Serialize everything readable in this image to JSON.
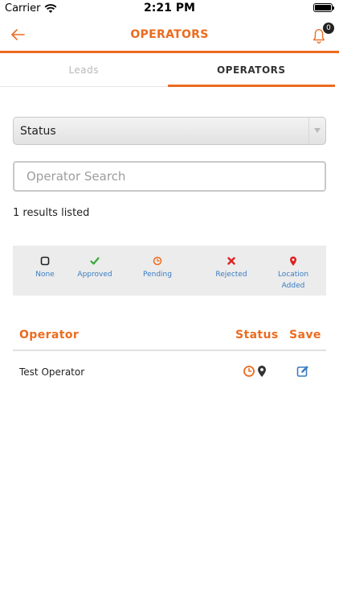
{
  "status_bar": {
    "carrier": "Carrier",
    "time": "2:21 PM"
  },
  "header": {
    "title": "OPERATORS",
    "notification_count": "0",
    "accent_color": "#ec6b1f"
  },
  "tabs": [
    {
      "label": "Leads",
      "active": false
    },
    {
      "label": "OPERATORS",
      "active": true
    }
  ],
  "status_filter": {
    "selected": "Status"
  },
  "search": {
    "placeholder": "Operator Search",
    "value": ""
  },
  "results_text": "1 results listed",
  "legend": [
    {
      "icon": "square-icon",
      "label": "None",
      "color": "#222222"
    },
    {
      "icon": "checkmark-icon",
      "label": "Approved",
      "color": "#3aa83a"
    },
    {
      "icon": "clock-icon",
      "label": "Pending",
      "color": "#ec6b1f"
    },
    {
      "icon": "x-icon",
      "label": "Rejected",
      "color": "#e02020"
    },
    {
      "icon": "location-pin-icon",
      "label_line1": "Location",
      "label_line2": "Added",
      "color": "#e02020"
    }
  ],
  "table": {
    "columns": {
      "operator": "Operator",
      "status": "Status",
      "save": "Save"
    },
    "rows": [
      {
        "name": "Test Operator",
        "status_icons": [
          "clock-icon",
          "location-pin-icon"
        ],
        "save_icon": "edit-icon"
      }
    ]
  }
}
